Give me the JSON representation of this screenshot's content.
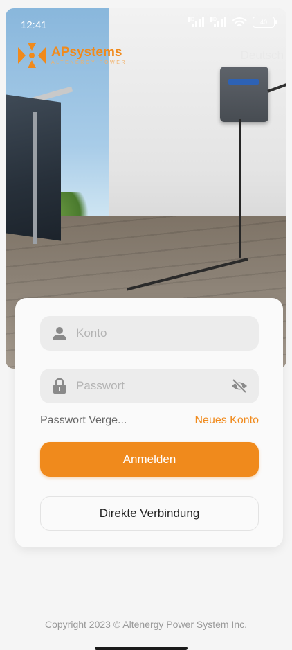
{
  "status_bar": {
    "time": "12:41",
    "signal_label_1": "HD",
    "signal_label_2": "HD",
    "battery": "40"
  },
  "brand": {
    "name_part1": "AP",
    "name_part2": "systems",
    "tagline": "ALTENERGY POWER"
  },
  "header": {
    "language": "Deutsch"
  },
  "login": {
    "account_placeholder": "Konto",
    "password_placeholder": "Passwort",
    "forgot_password": "Passwort Verge...",
    "new_account": "Neues Konto",
    "login_button": "Anmelden",
    "direct_connect_button": "Direkte Verbindung"
  },
  "footer": {
    "copyright": "Copyright 2023 © Altenergy Power System Inc."
  },
  "colors": {
    "accent": "#f08a1c"
  }
}
